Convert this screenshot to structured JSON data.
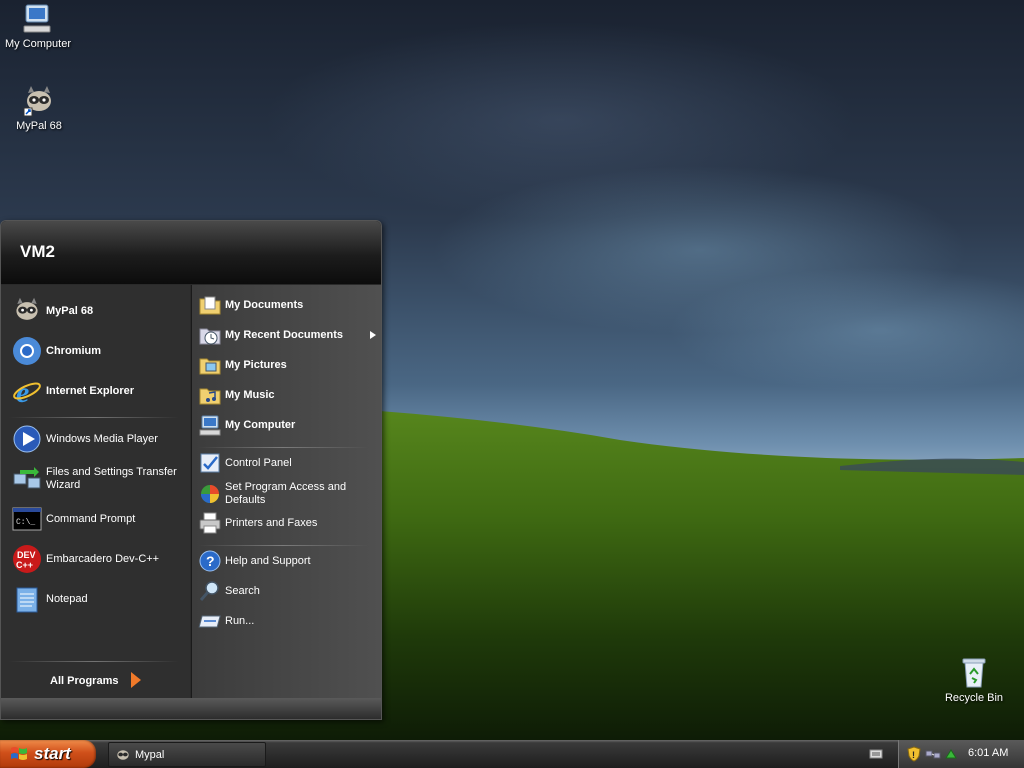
{
  "desktop": {
    "icons": [
      {
        "label": "My Computer"
      },
      {
        "label": "MyPal 68"
      },
      {
        "label": "Recycle Bin"
      }
    ]
  },
  "start_menu": {
    "user": "VM2",
    "pinned": [
      {
        "label": "MyPal 68",
        "icon": "raccoon-icon"
      },
      {
        "label": "Chromium",
        "icon": "chromium-icon"
      },
      {
        "label": "Internet Explorer",
        "icon": "ie-icon"
      }
    ],
    "recent": [
      {
        "label": "Windows Media Player",
        "icon": "media-player-icon"
      },
      {
        "label": "Files and Settings Transfer Wizard",
        "icon": "transfer-wizard-icon"
      },
      {
        "label": "Command Prompt",
        "icon": "cmd-icon"
      },
      {
        "label": "Embarcadero Dev-C++",
        "icon": "devcpp-icon"
      },
      {
        "label": "Notepad",
        "icon": "notepad-icon"
      }
    ],
    "all_programs": "All Programs",
    "right_top": [
      {
        "label": "My Documents",
        "icon": "folder-documents-icon"
      },
      {
        "label": "My Recent Documents",
        "icon": "recent-documents-icon"
      },
      {
        "label": "My Pictures",
        "icon": "folder-pictures-icon"
      },
      {
        "label": "My Music",
        "icon": "folder-music-icon"
      },
      {
        "label": "My Computer",
        "icon": "computer-icon"
      }
    ],
    "right_mid": [
      {
        "label": "Control Panel",
        "icon": "control-panel-icon"
      },
      {
        "label": "Set Program Access and Defaults",
        "icon": "program-access-icon"
      },
      {
        "label": "Printers and Faxes",
        "icon": "printer-icon"
      }
    ],
    "right_bottom": [
      {
        "label": "Help and Support",
        "icon": "help-icon"
      },
      {
        "label": "Search",
        "icon": "search-icon"
      },
      {
        "label": "Run...",
        "icon": "run-icon"
      }
    ]
  },
  "taskbar": {
    "start_label": "start",
    "tasks": [
      {
        "label": "Mypal"
      }
    ],
    "clock": "6:01 AM"
  },
  "colors": {
    "start_button": "#d0501a",
    "menu_bg": "#2f2f2f",
    "taskbar": "#2a2a2a"
  }
}
